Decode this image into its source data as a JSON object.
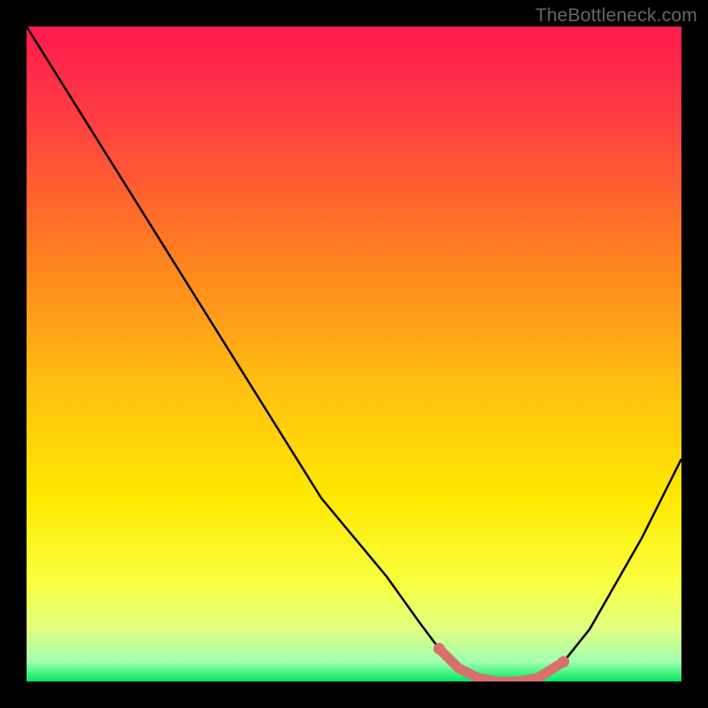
{
  "watermark": "TheBottleneck.com",
  "chart_data": {
    "type": "line",
    "title": "",
    "xlabel": "",
    "ylabel": "",
    "xlim": [
      0,
      100
    ],
    "ylim": [
      0,
      100
    ],
    "x": [
      0,
      5,
      10,
      15,
      20,
      25,
      30,
      35,
      40,
      45,
      50,
      55,
      60,
      63,
      66,
      69,
      72,
      75,
      78,
      82,
      86,
      90,
      94,
      98,
      100
    ],
    "values": [
      100,
      92,
      84,
      76,
      68,
      60,
      52,
      44,
      36,
      28,
      22,
      16,
      9,
      5,
      2,
      0.5,
      0,
      0,
      0.5,
      3,
      8,
      15,
      22,
      30,
      34
    ],
    "annotations": [
      {
        "type": "highlight_band",
        "x_start": 63,
        "x_end": 82,
        "color": "#d9706d"
      }
    ],
    "background_gradient": {
      "stops": [
        {
          "offset": 0,
          "color": "#ff1a4f"
        },
        {
          "offset": 0.15,
          "color": "#ff4040"
        },
        {
          "offset": 0.35,
          "color": "#ff8020"
        },
        {
          "offset": 0.55,
          "color": "#ffc010"
        },
        {
          "offset": 0.72,
          "color": "#ffe800"
        },
        {
          "offset": 0.85,
          "color": "#f8ff40"
        },
        {
          "offset": 0.92,
          "color": "#e0ff80"
        },
        {
          "offset": 0.97,
          "color": "#a0ffb0"
        },
        {
          "offset": 1.0,
          "color": "#00e860"
        }
      ]
    }
  }
}
